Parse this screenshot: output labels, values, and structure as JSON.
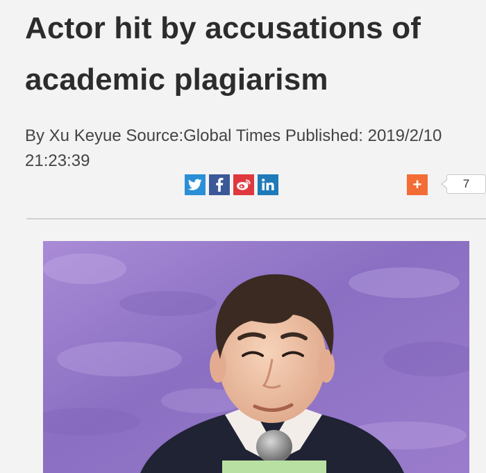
{
  "article": {
    "headline": "Actor hit by accusations of academic plagiarism",
    "byline": "By Xu Keyue Source:Global Times Published: 2019/2/10 21:23:39"
  },
  "share": {
    "buttons": [
      {
        "icon": "twitter-icon",
        "glyph": "t",
        "color": "#2a8fd6"
      },
      {
        "icon": "facebook-icon",
        "glyph": "f",
        "color": "#3b5998"
      },
      {
        "icon": "weibo-icon",
        "glyph": "w",
        "color": "#e0383f"
      },
      {
        "icon": "linkedin-icon",
        "glyph": "in",
        "color": "#1f7ab8"
      }
    ],
    "plus_glyph": "+",
    "count": "7"
  },
  "colors": {
    "background": "#f3f3f3",
    "text": "#2c2c2c",
    "plus": "#f36c35"
  }
}
